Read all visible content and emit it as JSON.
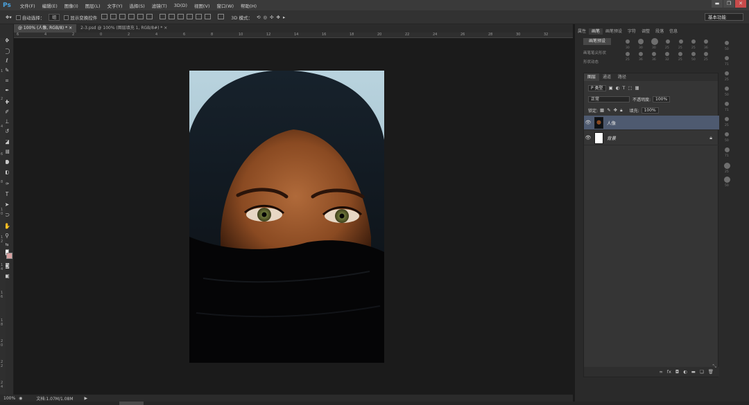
{
  "app": {
    "logo": "Ps"
  },
  "menu": [
    "文件(F)",
    "编辑(E)",
    "图像(I)",
    "图层(L)",
    "文字(Y)",
    "选择(S)",
    "滤镜(T)",
    "3D(D)",
    "视图(V)",
    "窗口(W)",
    "帮助(H)"
  ],
  "window_controls": {
    "minimize": "▬",
    "restore": "❐",
    "close": "✕"
  },
  "options": {
    "auto_select_label": "自动选择：",
    "auto_select_value": "组",
    "show_transform_label": "显示变换控件",
    "mode_3d_label": "3D 模式：",
    "workspace": "基本功能"
  },
  "tabs": [
    {
      "label": "@ 100% (人像, RGB/8) *",
      "close": "×"
    },
    {
      "label": "2-3.psd @ 100% (图层填充 1, RGB/8#) *",
      "close": "×"
    }
  ],
  "ruler_top_ticks": [
    "6",
    "4",
    "2",
    "0",
    "2",
    "4",
    "6",
    "8",
    "10",
    "12",
    "14",
    "16",
    "18",
    "20",
    "22",
    "24",
    "26",
    "28",
    "30",
    "32"
  ],
  "ruler_left_ticks": [
    "1",
    "2",
    "4",
    "6",
    "8",
    "1 0",
    "1 2",
    "1 4",
    "1 6",
    "1 8",
    "2 0",
    "2 2",
    "2 4"
  ],
  "status": {
    "zoom": "100%",
    "doc": "文档:1.07M/1.08M",
    "arrow": "▶"
  },
  "brush_panel": {
    "tabs": [
      "属性",
      "画笔",
      "画笔预设",
      "字符",
      "调整",
      "段落",
      "信息"
    ],
    "active_tab": 1,
    "presets_button": "画笔预设",
    "options": [
      "画笔笔尖形状",
      "形状动态"
    ],
    "sizes": [
      "30",
      "30",
      "30",
      "25",
      "25",
      "25",
      "36",
      "25",
      "36",
      "36",
      "32",
      "25",
      "50",
      "25",
      "50",
      "71",
      "25",
      "50",
      "71",
      "25",
      "50",
      "71",
      "25",
      "50"
    ]
  },
  "layers_panel": {
    "tabs": [
      "图层",
      "通道",
      "路径"
    ],
    "active_tab": 0,
    "filter_kind": "P 类型",
    "blend_mode": "正常",
    "opacity_label": "不透明度:",
    "opacity_value": "100%",
    "lock_label": "锁定:",
    "fill_label": "填充:",
    "fill_value": "100%",
    "layers": [
      {
        "name": "人像",
        "visible": true,
        "selected": true,
        "locked": false
      },
      {
        "name": "背景",
        "visible": true,
        "selected": false,
        "locked": true
      }
    ],
    "footer_icons": [
      "link",
      "fx",
      "mask",
      "adjustment",
      "group",
      "new",
      "delete"
    ]
  },
  "colors": {
    "accent": "#4aa3df",
    "selected_layer": "#4e5a70",
    "foreground": "#ffffff",
    "background": "#d8a2a2"
  }
}
